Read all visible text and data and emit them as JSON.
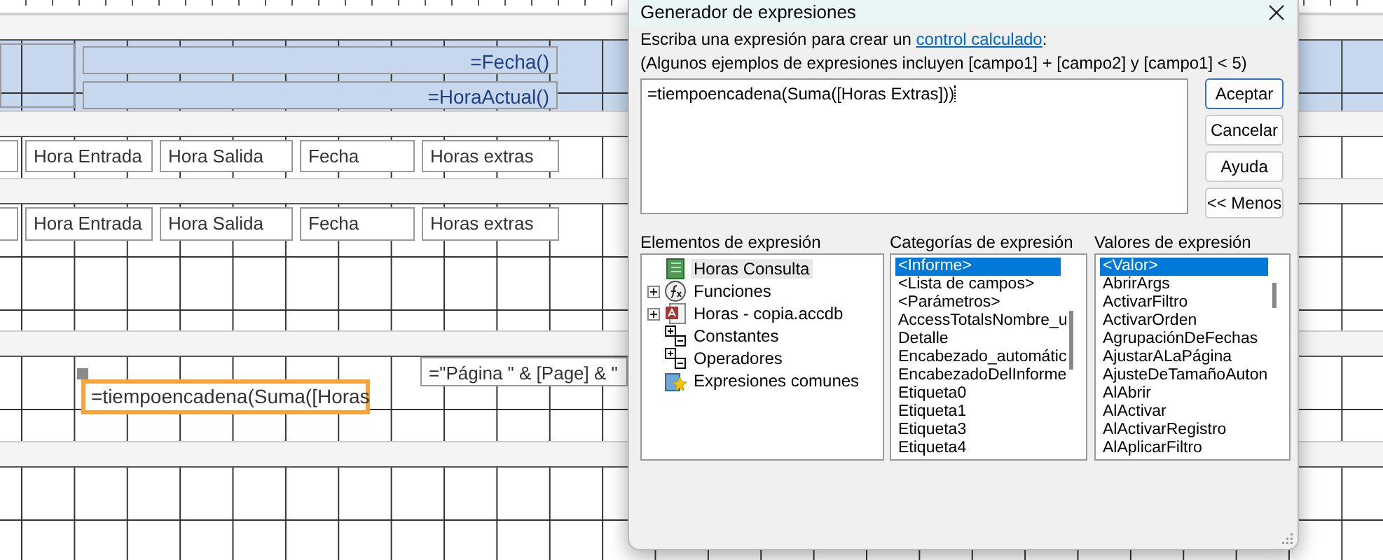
{
  "report": {
    "page_header": {
      "controls": [
        "=Fecha()",
        "=HoraActual()"
      ]
    },
    "label_row": [
      "Hora Entrada",
      "Hora Salida",
      "Fecha",
      "Horas extras"
    ],
    "detail_row": [
      "Hora Entrada",
      "Hora Salida",
      "Fecha",
      "Horas extras"
    ],
    "footer": {
      "page_expression": "=\"Página \" & [Page] & \"",
      "selected_control": {
        "text": "=tiempoencadena(Suma([Horas",
        "selected": true
      }
    }
  },
  "dialog": {
    "title": "Generador de expresiones",
    "instruction": "Escriba una expresión para crear un",
    "link": "control calculado",
    "instruction_end": ":",
    "examples": "(Algunos ejemplos de expresiones incluyen [campo1] + [campo2] y [campo1] < 5)",
    "expression": "=tiempoencadena(Suma([Horas Extras]))",
    "buttons": [
      {
        "label": "Aceptar",
        "default": true
      },
      {
        "label": "Cancelar",
        "default": false
      },
      {
        "label": "Ayuda",
        "default": false
      },
      {
        "label": "<< Menos",
        "default": false
      }
    ],
    "elements": {
      "label": "Elementos de expresión",
      "items": [
        {
          "label": "Horas Consulta",
          "kind": "query",
          "expandable": false,
          "selected": true
        },
        {
          "label": "Funciones",
          "kind": "functions",
          "expandable": true,
          "selected": false
        },
        {
          "label": "Horas - copia.accdb",
          "kind": "database",
          "expandable": true,
          "selected": false
        },
        {
          "label": "Constantes",
          "kind": "constants",
          "expandable": false,
          "selected": false
        },
        {
          "label": "Operadores",
          "kind": "operators",
          "expandable": false,
          "selected": false
        },
        {
          "label": "Expresiones comunes",
          "kind": "common",
          "expandable": false,
          "selected": false
        }
      ]
    },
    "categories": {
      "label": "Categorías de expresión",
      "items": [
        {
          "label": "<Informe>",
          "selected": true
        },
        {
          "label": "<Lista de campos>",
          "selected": false
        },
        {
          "label": "<Parámetros>",
          "selected": false
        },
        {
          "label": "AccessTotalsNombre_u",
          "selected": false
        },
        {
          "label": "Detalle",
          "selected": false
        },
        {
          "label": "Encabezado_automátic",
          "selected": false
        },
        {
          "label": "EncabezadoDelInforme",
          "selected": false
        },
        {
          "label": "Etiqueta0",
          "selected": false
        },
        {
          "label": "Etiqueta1",
          "selected": false
        },
        {
          "label": "Etiqueta3",
          "selected": false
        },
        {
          "label": "Etiqueta4",
          "selected": false
        }
      ]
    },
    "values": {
      "label": "Valores de expresión",
      "items": [
        {
          "label": "<Valor>",
          "selected": true
        },
        {
          "label": "AbrirArgs",
          "selected": false
        },
        {
          "label": "ActivarFiltro",
          "selected": false
        },
        {
          "label": "ActivarOrden",
          "selected": false
        },
        {
          "label": "AgrupaciónDeFechas",
          "selected": false
        },
        {
          "label": "AjustarALaPágina",
          "selected": false
        },
        {
          "label": "AjusteDeTamañoAuton",
          "selected": false
        },
        {
          "label": "AlAbrir",
          "selected": false
        },
        {
          "label": "AlActivar",
          "selected": false
        },
        {
          "label": "AlActivarRegistro",
          "selected": false
        },
        {
          "label": "AlAplicarFiltro",
          "selected": false
        }
      ]
    }
  }
}
